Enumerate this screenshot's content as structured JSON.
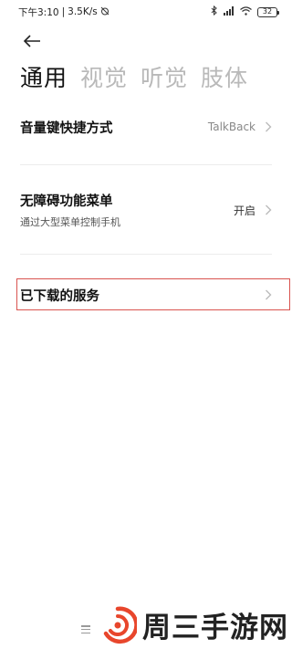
{
  "status_bar": {
    "time": "下午3:10",
    "separator": "|",
    "speed": "3.5K/s",
    "battery": "32",
    "icons": [
      "alarm-off-icon",
      "bluetooth-icon",
      "signal-icon",
      "wifi-icon",
      "battery-icon"
    ]
  },
  "tabs": [
    {
      "label": "通用",
      "active": true
    },
    {
      "label": "视觉",
      "active": false
    },
    {
      "label": "听觉",
      "active": false
    },
    {
      "label": "肢体",
      "active": false
    }
  ],
  "settings": {
    "volume_shortcut": {
      "title": "音量键快捷方式",
      "value": "TalkBack"
    },
    "accessibility_menu": {
      "title": "无障碍功能菜单",
      "subtitle": "通过大型菜单控制手机",
      "value": "开启"
    },
    "downloaded_services": {
      "title": "已下载的服务"
    }
  },
  "watermark": {
    "text": "周三手游网"
  },
  "colors": {
    "highlight": "#d9534f",
    "inactive_tab": "#b9b9b9",
    "watermark_logo": "#e8462c"
  }
}
